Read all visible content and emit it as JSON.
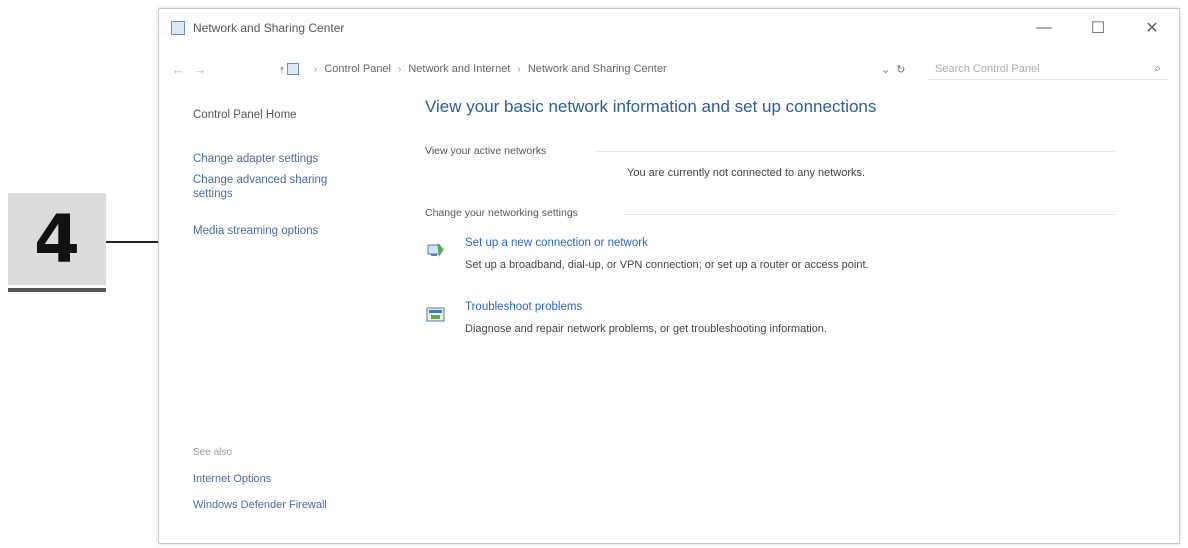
{
  "callout": {
    "number": "4"
  },
  "window": {
    "title": "Network and Sharing Center",
    "controls": {
      "minimize": "—",
      "maximize": "☐",
      "close": "✕"
    }
  },
  "addressbar": {
    "back": "←",
    "forward": "→",
    "up": "↑",
    "breadcrumbs": [
      "Control Panel",
      "Network and Internet",
      "Network and Sharing Center"
    ],
    "dropdown": "⌄",
    "refresh": "↻",
    "search_placeholder": "Search Control Panel",
    "search_icon": "search-icon"
  },
  "sidebar": {
    "home": "Control Panel Home",
    "links": [
      "Change adapter settings",
      "Change advanced sharing settings",
      "Media streaming options"
    ],
    "see_also_title": "See also",
    "see_also": [
      "Internet Options",
      "Windows Defender Firewall"
    ]
  },
  "main": {
    "heading": "View your basic network information and set up connections",
    "active_networks_label": "View your active networks",
    "not_connected": "You are currently not connected to any networks.",
    "change_settings_label": "Change your networking settings",
    "tasks": [
      {
        "icon": "network-setup-icon",
        "link": "Set up a new connection or network",
        "description": "Set up a broadband, dial-up, or VPN connection; or set up a router or access point."
      },
      {
        "icon": "troubleshoot-icon",
        "link": "Troubleshoot problems",
        "description": "Diagnose and repair network problems, or get troubleshooting information."
      }
    ]
  },
  "colors": {
    "link": "#2a66c4",
    "heading": "#2a5d9c",
    "callout_bg": "#dcdcdc"
  }
}
